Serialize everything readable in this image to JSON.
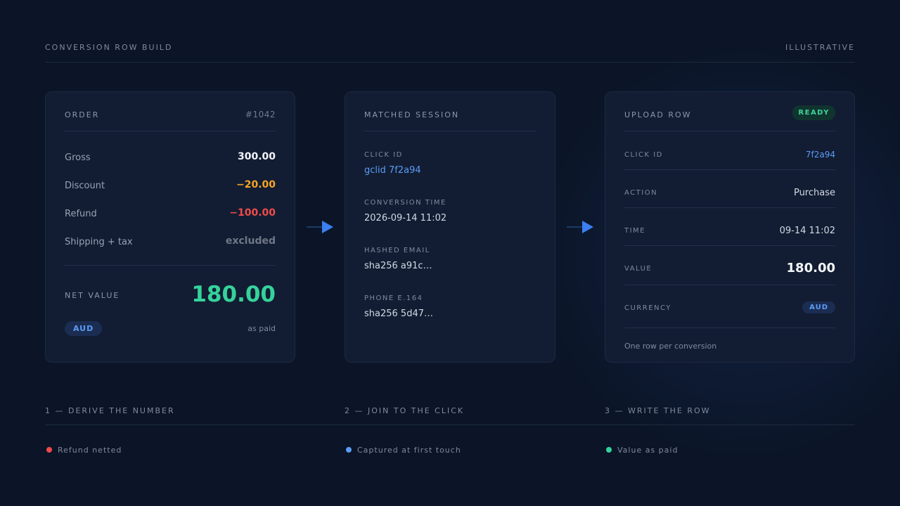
{
  "header": {
    "title": "CONVERSION ROW BUILD",
    "tag": "ILLUSTRATIVE"
  },
  "order": {
    "title": "ORDER",
    "id": "#1042",
    "lines": [
      {
        "label": "Gross",
        "value": "300.00"
      },
      {
        "label": "Discount",
        "value": "−20.00"
      },
      {
        "label": "Refund",
        "value": "−100.00"
      },
      {
        "label": "Shipping + tax",
        "value": "excluded"
      }
    ],
    "net_label": "NET VALUE",
    "net_value": "180.00",
    "currency": "AUD",
    "note": "as paid"
  },
  "session": {
    "title": "MATCHED SESSION",
    "fields": [
      {
        "label": "CLICK ID",
        "value": "gclid 7f2a94"
      },
      {
        "label": "CONVERSION TIME",
        "value": "2026-09-14 11:02"
      },
      {
        "label": "HASHED EMAIL",
        "value": "sha256 a91c…"
      },
      {
        "label": "PHONE E.164",
        "value": "sha256 5d47…"
      }
    ]
  },
  "upload": {
    "title": "UPLOAD ROW",
    "status": "READY",
    "rows": [
      {
        "label": "CLICK ID",
        "value": "7f2a94"
      },
      {
        "label": "ACTION",
        "value": "Purchase"
      },
      {
        "label": "TIME",
        "value": "09-14 11:02"
      },
      {
        "label": "VALUE",
        "value": "180.00"
      },
      {
        "label": "CURRENCY",
        "value": "AUD"
      }
    ],
    "footnote": "One row per conversion"
  },
  "steps": [
    {
      "label": "1 — DERIVE THE NUMBER",
      "legend": "Refund netted",
      "color": "#ef4b4b"
    },
    {
      "label": "2 — JOIN TO THE CLICK",
      "legend": "Captured at first touch",
      "color": "#5b9cf5"
    },
    {
      "label": "3 — WRITE THE ROW",
      "legend": "Value as paid",
      "color": "#35d39b"
    }
  ],
  "colors": {
    "accent_blue": "#3b7ff0",
    "net_green": "#35d39b",
    "discount_orange": "#f5a524",
    "refund_red": "#ef4b4b"
  },
  "icons": {
    "flow_arrow": "arrow-right-icon",
    "legend_dot": "dot-icon"
  }
}
